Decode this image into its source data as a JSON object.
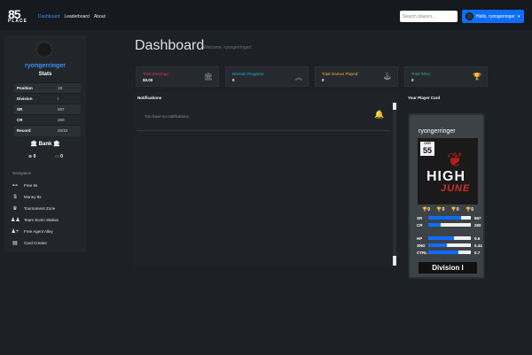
{
  "nav": {
    "logo_top": "85",
    "logo_bottom": "PLACE",
    "links": [
      "Dashboard",
      "Leaderboard",
      "About"
    ],
    "search_placeholder": "Search players...",
    "user_label": "Hello, ryongerringer",
    "user_caret": "▾"
  },
  "sidebar": {
    "username": "ryongerringer",
    "stats_title": "Stats",
    "stats": [
      {
        "key": "Position",
        "value": "19"
      },
      {
        "key": "Division",
        "value": "I"
      },
      {
        "key": "SR",
        "value": "667"
      },
      {
        "key": "CR",
        "value": "260"
      },
      {
        "key": "Record",
        "value": "26/10"
      }
    ],
    "bank_label": "Bank",
    "coins_a": "0",
    "coins_b": "0",
    "nav_title": "Navigation",
    "menu": [
      "Free 8s",
      "Money 8s",
      "Tournament Zone",
      "Team Scrim Station",
      "Free Agent Alley",
      "Card Creator"
    ]
  },
  "main": {
    "title": "Dashboard",
    "welcome": "Welcome, ryongerringer!",
    "cards": [
      {
        "label": "Total Earnings:",
        "value": "$0.00",
        "color": "#e8334f"
      },
      {
        "label": "Division Progress:",
        "value": "0",
        "color": "#1bb6d6"
      },
      {
        "label": "Total Games Played:",
        "value": "0",
        "color": "#f0b52a"
      },
      {
        "label": "Total Wins:",
        "value": "0",
        "color": "#2bb673"
      }
    ],
    "notifications_title": "Notifications",
    "notifications_empty": "You have no notifications"
  },
  "player_card": {
    "section_title": "Your Player Card",
    "name": "ryongerringer",
    "ovr_label": "OVR",
    "ovr": "55",
    "art_line1": "HIGH",
    "art_line2": "JUNE",
    "trophies": [
      "0",
      "0",
      "0",
      "0"
    ],
    "ratings": [
      {
        "key": "SR",
        "value": "667",
        "fill": 0.78
      },
      {
        "key": "CR",
        "value": "260",
        "fill": 0.3
      }
    ],
    "attributes": [
      {
        "key": "HP",
        "value": "0.6",
        "fill": 0.6
      },
      {
        "key": "SND",
        "value": "0.44",
        "fill": 0.44
      },
      {
        "key": "CTRL",
        "value": "0.7",
        "fill": 0.7
      }
    ],
    "division": "Division I"
  }
}
